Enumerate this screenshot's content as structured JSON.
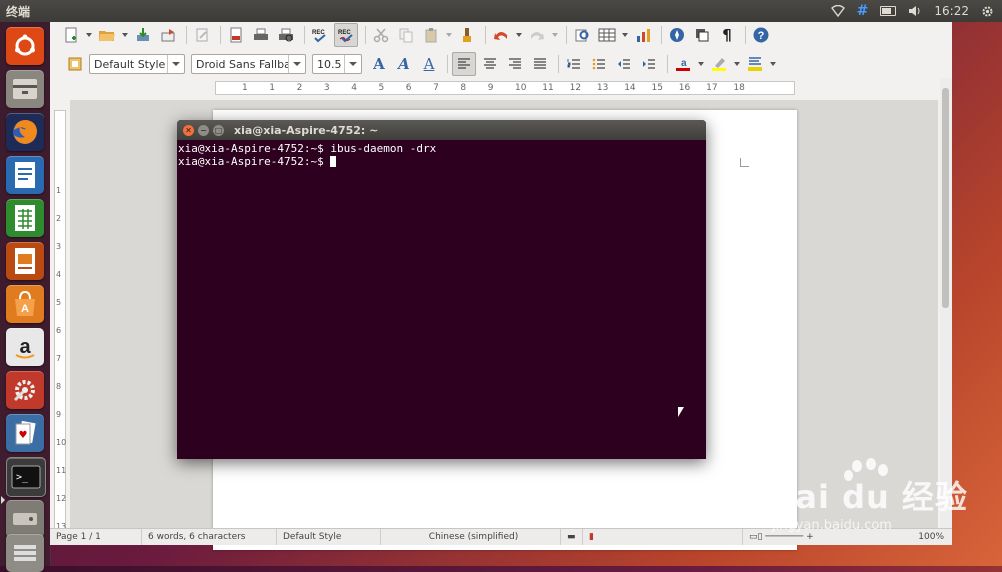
{
  "top_panel": {
    "window_title": "终端",
    "clock": "16:22",
    "indicators": [
      "wifi-icon",
      "keyboard-layout-icon",
      "battery-icon",
      "volume-icon",
      "power-gear-icon"
    ]
  },
  "launcher": {
    "items": [
      {
        "name": "dash-home",
        "icon": "ubuntu-logo-icon",
        "color": "#dd4814"
      },
      {
        "name": "files",
        "icon": "file-cabinet-icon",
        "color": "#8a8680"
      },
      {
        "name": "firefox",
        "icon": "firefox-icon",
        "color": "#e66000"
      },
      {
        "name": "writer",
        "icon": "writer-document-icon",
        "color": "#2a6ab0"
      },
      {
        "name": "calc",
        "icon": "calc-spreadsheet-icon",
        "color": "#2e8b2e"
      },
      {
        "name": "impress",
        "icon": "impress-presentation-icon",
        "color": "#b84a12"
      },
      {
        "name": "software-center",
        "icon": "shopping-bag-icon",
        "color": "#e07b20"
      },
      {
        "name": "amazon",
        "icon": "amazon-icon",
        "color": "#e8e8e8"
      },
      {
        "name": "system-settings",
        "icon": "gear-wrench-icon",
        "color": "#c0392b"
      },
      {
        "name": "solitaire",
        "icon": "playing-cards-icon",
        "color": "#3a6ea5"
      },
      {
        "name": "terminal",
        "icon": "terminal-icon",
        "color": "#333333"
      },
      {
        "name": "drive",
        "icon": "disk-drive-icon",
        "color": "#7f7b75"
      },
      {
        "name": "trash",
        "icon": "stack-icon",
        "color": "#8f8b85"
      }
    ]
  },
  "writer": {
    "paragraph_style": "Default Style",
    "font_name": "Droid Sans Fallbac",
    "font_size": "10.5",
    "ruler_numbers": [
      "1",
      "1",
      "2",
      "3",
      "4",
      "5",
      "6",
      "7",
      "8",
      "9",
      "10",
      "11",
      "12",
      "13",
      "14",
      "15",
      "16",
      "17",
      "18"
    ],
    "vruler_numbers": [
      "1",
      "2",
      "3",
      "4",
      "5",
      "6",
      "7",
      "8",
      "9",
      "10",
      "11",
      "12",
      "13"
    ],
    "status": {
      "page": "Page 1 / 1",
      "words": "6 words, 6 characters",
      "style": "Default Style",
      "language": "Chinese (simplified)",
      "zoom": "100%"
    }
  },
  "terminal": {
    "title": "xia@xia-Aspire-4752: ~",
    "lines": [
      "xia@xia-Aspire-4752:~$ ibus-daemon -drx",
      "xia@xia-Aspire-4752:~$ "
    ]
  },
  "watermark": {
    "logo": "Bai du 经验",
    "url": "jingyan.baidu.com"
  }
}
